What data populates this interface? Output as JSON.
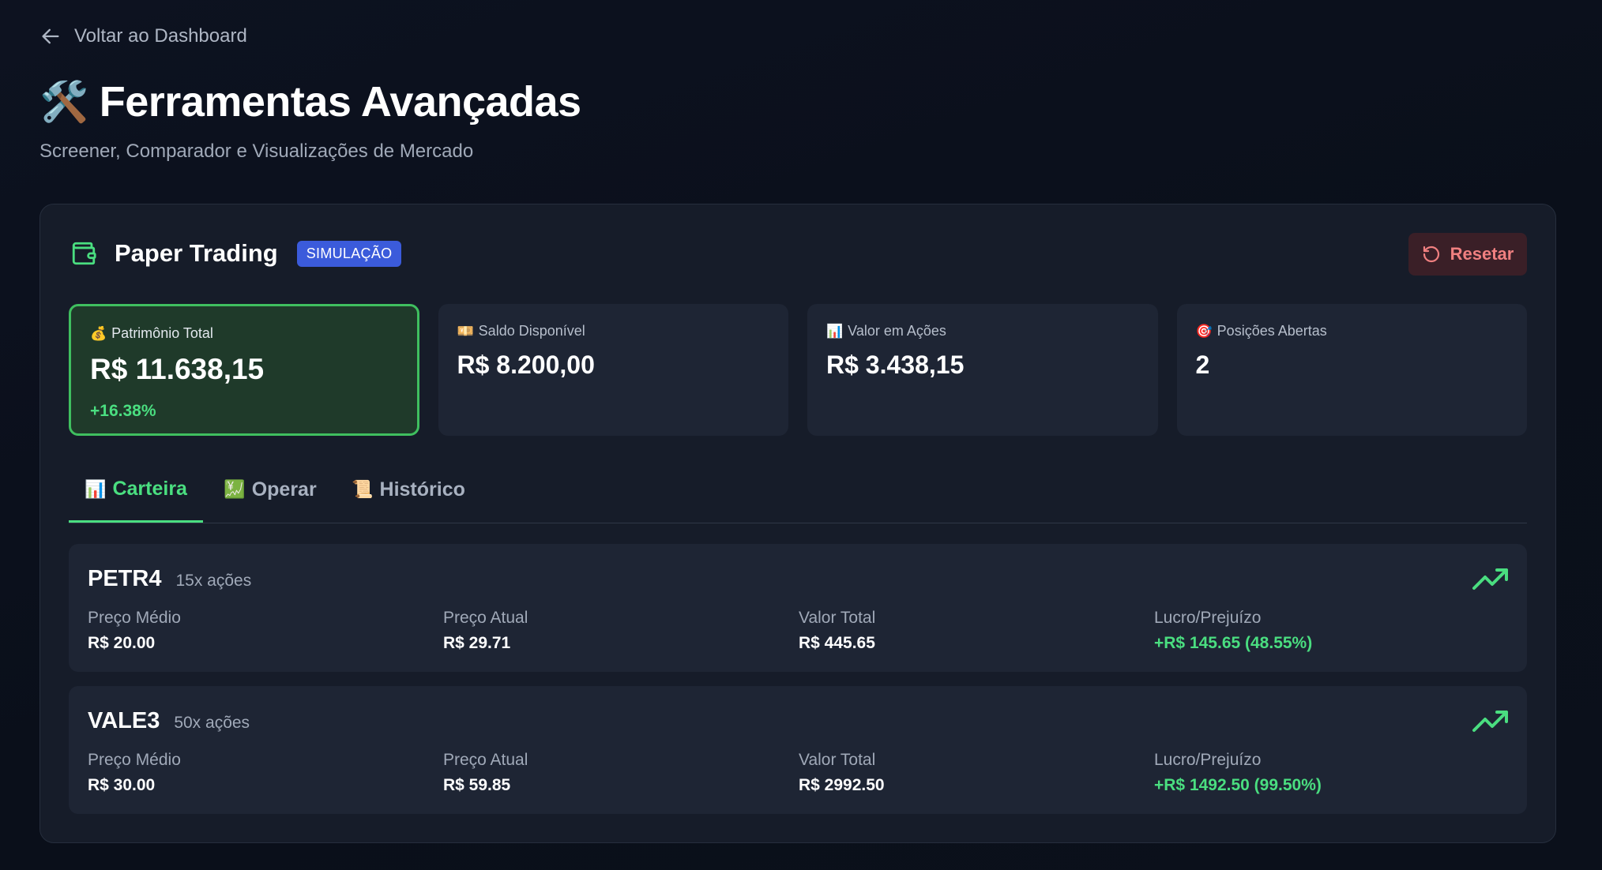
{
  "nav": {
    "back_label": "Voltar ao Dashboard"
  },
  "header": {
    "emoji": "🛠️",
    "title": "Ferramentas Avançadas",
    "subtitle": "Screener, Comparador e Visualizações de Mercado"
  },
  "card": {
    "title": "Paper Trading",
    "badge": "SIMULAÇÃO",
    "reset_label": "Resetar"
  },
  "stats": [
    {
      "icon": "💰",
      "label": "Patrimônio Total",
      "value": "R$ 11.638,15",
      "change": "+16.38%"
    },
    {
      "icon": "💴",
      "label": "Saldo Disponível",
      "value": "R$ 8.200,00"
    },
    {
      "icon": "📊",
      "label": "Valor em Ações",
      "value": "R$ 3.438,15"
    },
    {
      "icon": "🎯",
      "label": "Posições Abertas",
      "value": "2"
    }
  ],
  "tabs": [
    {
      "icon": "📊",
      "label": "Carteira"
    },
    {
      "icon": "💹",
      "label": "Operar"
    },
    {
      "icon": "📜",
      "label": "Histórico"
    }
  ],
  "positions": [
    {
      "ticker": "PETR4",
      "quantity": "15x ações",
      "avg_label": "Preço Médio",
      "avg_value": "R$ 20.00",
      "current_label": "Preço Atual",
      "current_value": "R$ 29.71",
      "total_label": "Valor Total",
      "total_value": "R$ 445.65",
      "pl_label": "Lucro/Prejuízo",
      "pl_value": "+R$ 145.65 (48.55%)"
    },
    {
      "ticker": "VALE3",
      "quantity": "50x ações",
      "avg_label": "Preço Médio",
      "avg_value": "R$ 30.00",
      "current_label": "Preço Atual",
      "current_value": "R$ 59.85",
      "total_label": "Valor Total",
      "total_value": "R$ 2992.50",
      "pl_label": "Lucro/Prejuízo",
      "pl_value": "+R$ 1492.50 (99.50%)"
    }
  ],
  "colors": {
    "accent_green": "#4ade80",
    "badge_blue": "#3b5bdb",
    "reset_red": "#f08080",
    "card_bg": "#161c29"
  },
  "icons": {
    "back": "arrow-left-icon",
    "wallet": "wallet-icon",
    "reset": "rotate-ccw-icon",
    "trend": "trending-up-icon"
  }
}
